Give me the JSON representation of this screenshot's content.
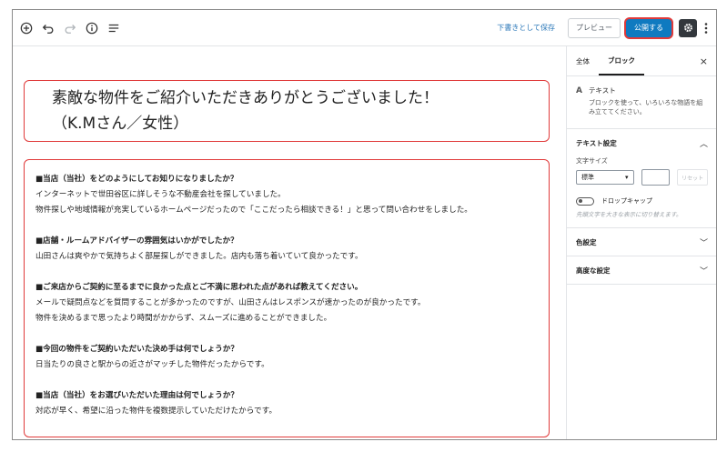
{
  "toolbar": {
    "icons": [
      "add-block-icon",
      "undo-icon",
      "redo-icon",
      "info-icon",
      "list-view-icon"
    ],
    "save_draft": "下書きとして保存",
    "preview": "プレビュー",
    "publish": "公開する",
    "settings_icon": "gear-icon",
    "more_icon": "more-vertical-icon"
  },
  "editor": {
    "title_lines": [
      "素敵な物件をご紹介いただきありがとうございました！",
      "（K.Mさん／女性）"
    ],
    "qa": [
      {
        "q": "■当店（当社）をどのようにしてお知りになりましたか？",
        "a": [
          "インターネットで世田谷区に詳しそうな不動産会社を探していました。",
          "物件探しや地域情報が充実しているホームページだったので「ここだったら相談できる！」と思って問い合わせをしました。"
        ]
      },
      {
        "q": "■店舗・ルームアドバイザーの雰囲気はいかがでしたか？",
        "a": [
          "山田さんは爽やかで気持ちよく部屋探しができました。店内も落ち着いていて良かったです。"
        ]
      },
      {
        "q": "■ご来店からご契約に至るまでに良かった点とご不満に思われた点があれば教えてください。",
        "a": [
          "メールで疑問点などを質問することが多かったのですが、山田さんはレスポンスが速かったのが良かったです。",
          "物件を決めるまで思ったより時間がかからず、スムーズに進めることができました。"
        ]
      },
      {
        "q": "■今回の物件をご契約いただいた決め手は何でしょうか？",
        "a": [
          "日当たりの良さと駅からの近さがマッチした物件だったからです。"
        ]
      },
      {
        "q": "■当店（当社）をお選びいただいた理由は何でしょうか？",
        "a": [
          "対応が早く、希望に沿った物件を複数提示していただけたからです。"
        ]
      }
    ]
  },
  "sidebar": {
    "tabs": [
      "全体",
      "ブロック"
    ],
    "active_tab": "ブロック",
    "close": "×",
    "block": {
      "icon": "A",
      "title": "テキスト",
      "desc": "ブロックを使って、いろいろな物語を組み立ててください。"
    },
    "text_settings": {
      "heading": "テキスト設定",
      "font_size_label": "文字サイズ",
      "font_size_value": "標準",
      "reset": "リセット",
      "drop_cap_label": "ドロップキャップ",
      "drop_cap_help": "先頭文字を大きな表示に切り替えます。"
    },
    "color_settings": "色設定",
    "advanced": "高度な設定"
  },
  "colors": {
    "highlight": "#e03a3a",
    "publish": "#0f7ac0",
    "link": "#2a77b8"
  }
}
